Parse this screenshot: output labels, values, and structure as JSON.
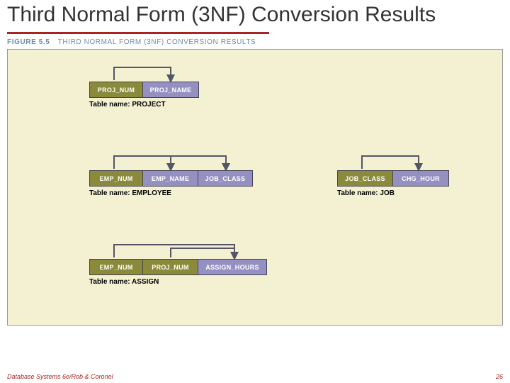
{
  "title": "Third Normal Form (3NF) Conversion Results",
  "figure": {
    "number": "FIGURE 5.5",
    "caption": "THIRD NORMAL FORM (3NF) CONVERSION RESULTS"
  },
  "tables": {
    "project": {
      "label": "Table name: PROJECT",
      "cols": {
        "proj_num": "PROJ_NUM",
        "proj_name": "PROJ_NAME"
      }
    },
    "employee": {
      "label": "Table name: EMPLOYEE",
      "cols": {
        "emp_num": "EMP_NUM",
        "emp_name": "EMP_NAME",
        "job_class": "JOB_CLASS"
      }
    },
    "job": {
      "label": "Table name: JOB",
      "cols": {
        "job_class": "JOB_CLASS",
        "chg_hour": "CHG_HOUR"
      }
    },
    "assign": {
      "label": "Table name: ASSIGN",
      "cols": {
        "emp_num": "EMP_NUM",
        "proj_num": "PROJ_NUM",
        "assign_hours": "ASSIGN_HOURS"
      }
    }
  },
  "footer": {
    "left": "Database Systems 6e/Rob & Coronel",
    "page": "26"
  }
}
